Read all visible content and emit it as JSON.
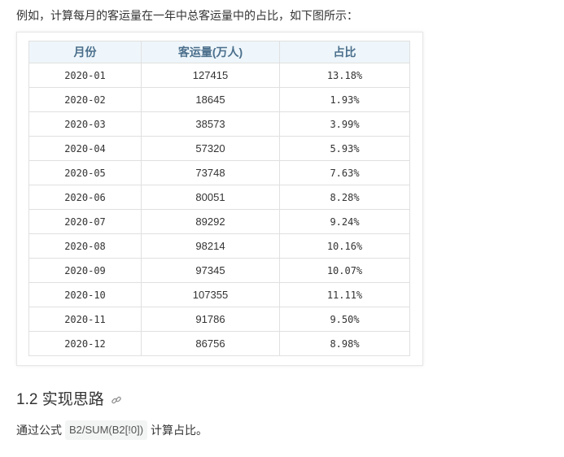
{
  "intro": "例如，计算每月的客运量在一年中总客运量中的占比，如下图所示：",
  "table": {
    "headers": [
      "月份",
      "客运量(万人)",
      "占比"
    ],
    "rows": [
      [
        "2020-01",
        "127415",
        "13.18%"
      ],
      [
        "2020-02",
        "18645",
        "1.93%"
      ],
      [
        "2020-03",
        "38573",
        "3.99%"
      ],
      [
        "2020-04",
        "57320",
        "5.93%"
      ],
      [
        "2020-05",
        "73748",
        "7.63%"
      ],
      [
        "2020-06",
        "80051",
        "8.28%"
      ],
      [
        "2020-07",
        "89292",
        "9.24%"
      ],
      [
        "2020-08",
        "98214",
        "10.16%"
      ],
      [
        "2020-09",
        "97345",
        "10.07%"
      ],
      [
        "2020-10",
        "107355",
        "11.11%"
      ],
      [
        "2020-11",
        "91786",
        "9.50%"
      ],
      [
        "2020-12",
        "86756",
        "8.98%"
      ]
    ]
  },
  "section": {
    "heading": "1.2 实现思路",
    "icon": "link-icon"
  },
  "paragraph": {
    "before": "通过公式",
    "code": "B2/SUM(B2[!0])",
    "after": "计算占比。"
  }
}
